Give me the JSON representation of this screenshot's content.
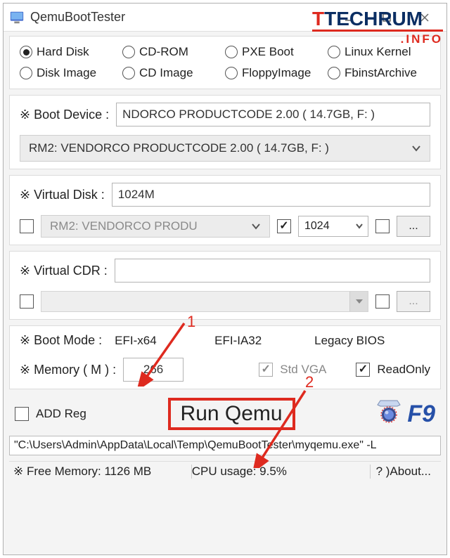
{
  "titlebar": {
    "title": "QemuBootTester"
  },
  "boot_types": {
    "row1": [
      {
        "label": "Hard Disk",
        "checked": true
      },
      {
        "label": "CD-ROM",
        "checked": false
      },
      {
        "label": "PXE Boot",
        "checked": false
      },
      {
        "label": "Linux Kernel",
        "checked": false
      }
    ],
    "row2": [
      {
        "label": "Disk Image",
        "checked": false
      },
      {
        "label": "CD Image",
        "checked": false
      },
      {
        "label": "FloppyImage",
        "checked": false
      },
      {
        "label": "FbinstArchive",
        "checked": false
      }
    ]
  },
  "boot_device": {
    "label": "※ Boot Device :",
    "value": "NDORCO PRODUCTCODE 2.00 ( 14.7GB,  F: )",
    "combo": "RM2: VENDORCO PRODUCTCODE 2.00 ( 14.7GB,  F: )"
  },
  "virtual_disk": {
    "label": "※ Virtual Disk :",
    "value": "1024M",
    "disabled_combo": "RM2: VENDORCO PRODU",
    "size_value": "1024",
    "dots": "..."
  },
  "virtual_cdr": {
    "label": "※ Virtual CDR :",
    "value": "",
    "dots": "..."
  },
  "boot_mode": {
    "label": "※ Boot Mode :",
    "options": [
      {
        "label": "EFI-x64",
        "checked": true
      },
      {
        "label": "EFI-IA32",
        "checked": false
      },
      {
        "label": "Legacy BIOS",
        "checked": false
      }
    ]
  },
  "memory": {
    "label": "※ Memory ( M ) :",
    "value": "266",
    "stdvga": "Std VGA",
    "readonly": "ReadOnly"
  },
  "footer": {
    "addreg": "ADD Reg",
    "run": "Run Qemu",
    "f9": "F9"
  },
  "cmdline": "\"C:\\Users\\Admin\\AppData\\Local\\Temp\\QemuBootTester\\myqemu.exe\" -L",
  "statusbar": {
    "mem": "※ Free Memory: 1126 MB",
    "cpu": "CPU usage: 9.5%",
    "about": "? )About..."
  },
  "annotations": {
    "n1": "1",
    "n2": "2"
  },
  "logo": {
    "top": "TECHRUM",
    "bottom": ".INFO"
  }
}
